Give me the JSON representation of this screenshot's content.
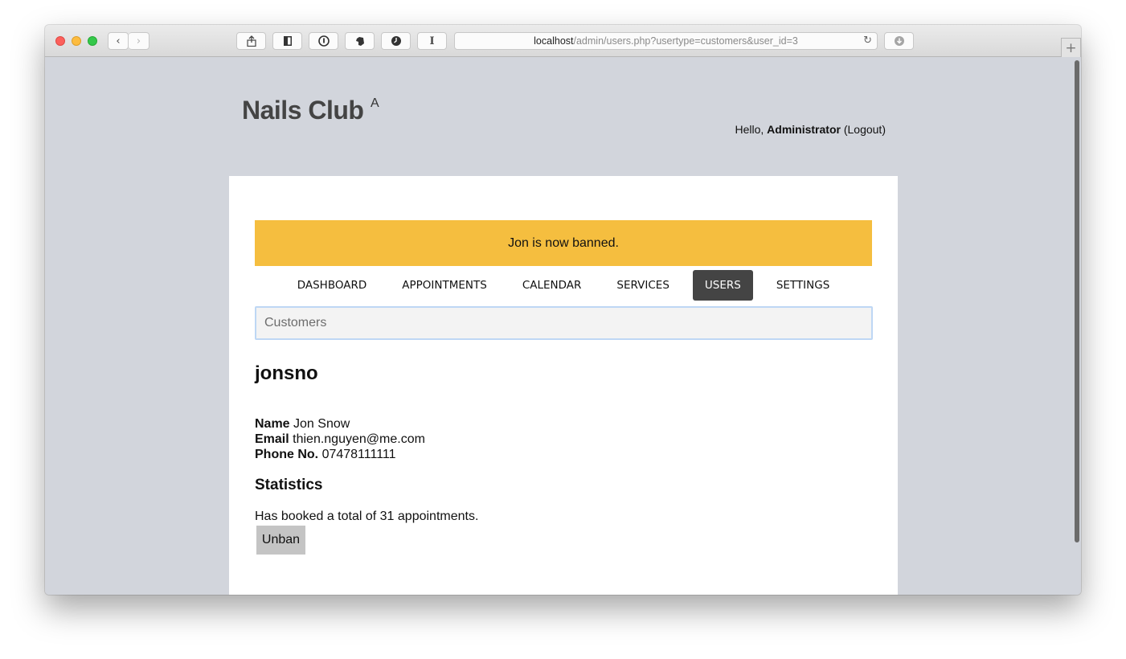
{
  "browser": {
    "url_host": "localhost",
    "url_path": "/admin/users.php?usertype=customers&user_id=3",
    "back_icon": "‹",
    "forward_icon": "›",
    "newtab_icon": "+"
  },
  "site": {
    "brand": "Nails Club",
    "brand_sup": "A",
    "greeting_prefix": "Hello, ",
    "greeting_user": "Administrator",
    "greeting_logout": "(Logout)"
  },
  "notice": {
    "text": "Jon is now banned.",
    "color": "#f5be3f"
  },
  "nav": {
    "items": [
      {
        "label": "DASHBOARD"
      },
      {
        "label": "APPOINTMENTS"
      },
      {
        "label": "CALENDAR"
      },
      {
        "label": "SERVICES"
      },
      {
        "label": "USERS",
        "active": true
      },
      {
        "label": "SETTINGS"
      }
    ]
  },
  "usertype_select": {
    "value": "Customers"
  },
  "profile": {
    "username": "jonsno",
    "name_label": "Name",
    "name_value": "Jon Snow",
    "email_label": "Email",
    "email_value": "thien.nguyen@me.com",
    "phone_label": "Phone No.",
    "phone_value": "07478111111"
  },
  "statistics": {
    "title": "Statistics",
    "text": "Has booked a total of 31 appointments."
  },
  "actions": {
    "unban_label": "Unban"
  }
}
